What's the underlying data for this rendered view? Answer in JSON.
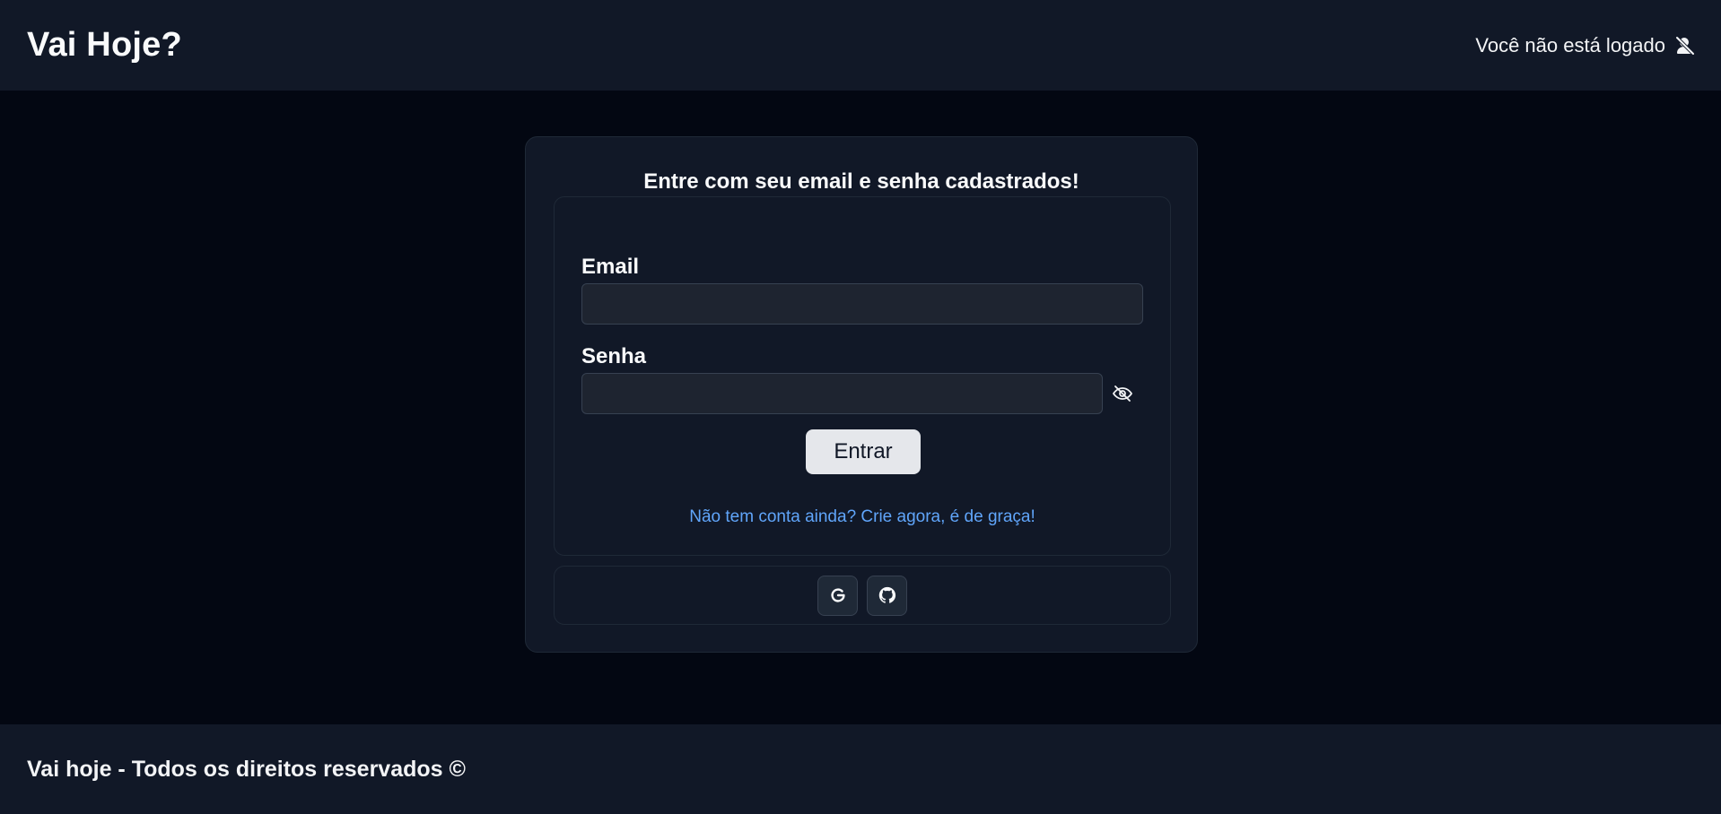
{
  "header": {
    "brand": "Vai Hoje?",
    "status_text": "Você não está logado",
    "status_icon": "user-off-icon"
  },
  "login": {
    "title": "Entre com seu email e senha cadastrados!",
    "email_label": "Email",
    "email_value": "",
    "password_label": "Senha",
    "password_value": "",
    "toggle_icon": "eye-off-icon",
    "submit_label": "Entrar",
    "signup_link": "Não tem conta ainda? Crie agora, é de graça!"
  },
  "social": {
    "providers": [
      "google-icon",
      "github-icon"
    ]
  },
  "footer": {
    "text": "Vai hoje - Todos os direitos reservados ©"
  },
  "colors": {
    "background": "#030712",
    "surface": "#111827",
    "border": "#1f2937",
    "link": "#60a5fa",
    "button": "#e5e7eb"
  }
}
